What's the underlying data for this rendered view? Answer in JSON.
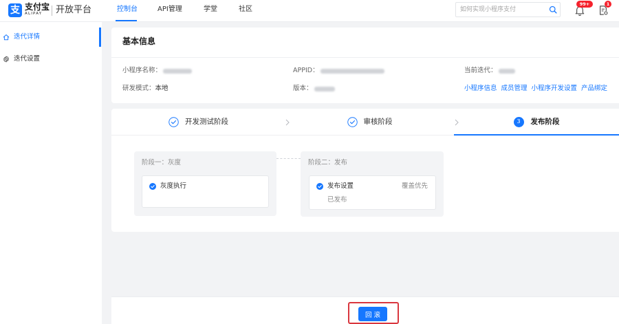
{
  "colors": {
    "accent": "#1677ff",
    "badge": "#f5222d",
    "annotation": "#d9363e",
    "background": "#f2f3f5"
  },
  "header": {
    "logo": {
      "mark": "支",
      "brand": "支付宝",
      "brand_en": "ALIPAY"
    },
    "platform": "开放平台",
    "nav": [
      {
        "label": "控制台",
        "active": true
      },
      {
        "label": "API管理",
        "active": false
      },
      {
        "label": "学堂",
        "active": false
      },
      {
        "label": "社区",
        "active": false
      }
    ],
    "search": {
      "placeholder": "如何实现小程序支付",
      "icon": "search-icon"
    },
    "notifications": {
      "icon": "bell-icon",
      "badge": "99+"
    },
    "todo": {
      "icon": "document-gear-icon",
      "badge": "1"
    }
  },
  "sidebar": {
    "items": [
      {
        "label": "迭代详情",
        "icon": "home-icon",
        "active": true
      },
      {
        "label": "迭代设置",
        "icon": "gear-icon",
        "active": false
      }
    ]
  },
  "basic_info": {
    "title": "基本信息",
    "fields": {
      "name": {
        "label": "小程序名称：",
        "redacted": true
      },
      "appid": {
        "label": "APPID：",
        "redacted": true
      },
      "iteration": {
        "label": "当前迭代：",
        "redacted": true
      },
      "dev_mode": {
        "label": "研发模式：",
        "value": "本地"
      },
      "version": {
        "label": "版本：",
        "redacted": true
      }
    },
    "links": [
      "小程序信息",
      "成员管理",
      "小程序开发设置",
      "产品绑定"
    ]
  },
  "steps": [
    {
      "label": "开发测试阶段",
      "completed": true,
      "icon": "check-circle-icon"
    },
    {
      "label": "审核阶段",
      "completed": true,
      "icon": "check-circle-icon"
    },
    {
      "label": "发布阶段",
      "active": true,
      "number": "3"
    }
  ],
  "stages": [
    {
      "title": "阶段一：灰度",
      "tasks": [
        {
          "label": "灰度执行",
          "completed": true
        }
      ]
    },
    {
      "title": "阶段二：发布",
      "tasks": [
        {
          "label": "发布设置",
          "completed": true,
          "tag": "覆盖优先",
          "state": "已发布"
        }
      ]
    }
  ],
  "footer": {
    "rollback_label": "回 滚"
  }
}
